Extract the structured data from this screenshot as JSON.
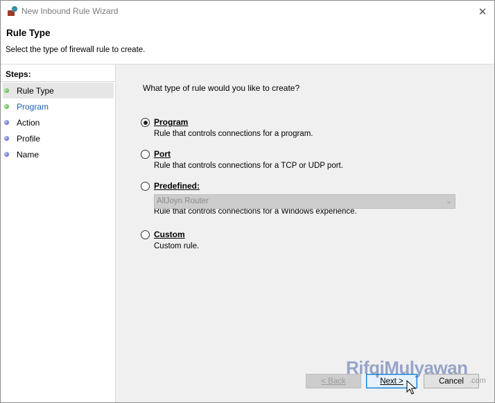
{
  "window": {
    "title": "New Inbound Rule Wizard",
    "close_glyph": "✕"
  },
  "header": {
    "title": "Rule Type",
    "subtitle": "Select the type of firewall rule to create."
  },
  "steps": {
    "label": "Steps:",
    "items": [
      {
        "label": "Rule Type",
        "status": "completed",
        "color": "#3fa62c"
      },
      {
        "label": "Program",
        "status": "link",
        "color": "#3fa62c"
      },
      {
        "label": "Action",
        "status": "pending",
        "color": "#3b50c0"
      },
      {
        "label": "Profile",
        "status": "pending",
        "color": "#3b50c0"
      },
      {
        "label": "Name",
        "status": "pending",
        "color": "#3b50c0"
      }
    ]
  },
  "content": {
    "question": "What type of rule would you like to create?",
    "options": [
      {
        "label": "Program",
        "description": "Rule that controls connections for a program.",
        "selected": true
      },
      {
        "label": "Port",
        "description": "Rule that controls connections for a TCP or UDP port.",
        "selected": false
      },
      {
        "label": "Predefined:",
        "description": "Rule that controls connections for a Windows experience.",
        "selected": false
      },
      {
        "label": "Custom",
        "description": "Custom rule.",
        "selected": false
      }
    ],
    "predefined_dropdown": {
      "value": "AllJoyn Router",
      "arrow_glyph": "⌄",
      "enabled": false
    }
  },
  "buttons": {
    "back": "< Back",
    "next": "Next >",
    "cancel": "Cancel"
  },
  "watermark": {
    "text": "RifqiMulyawan",
    "suffix": ".com"
  },
  "colors": {
    "accent": "#0078d7",
    "link": "#1a5fb4",
    "content_bg": "#f0f0f0"
  }
}
